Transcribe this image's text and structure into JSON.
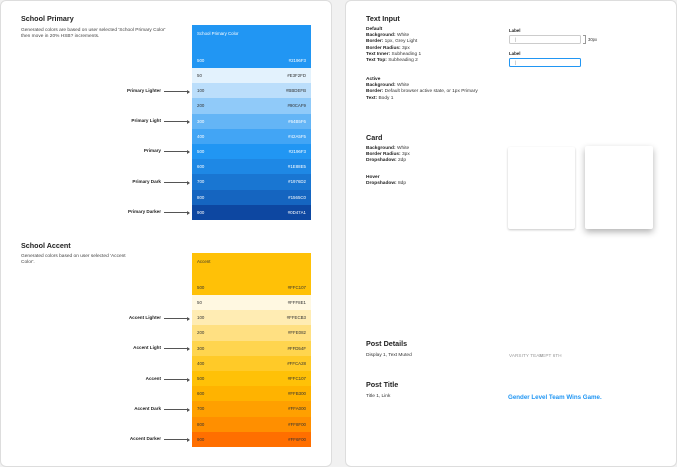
{
  "primary": {
    "title": "School Primary",
    "description": "Generated colors are based on user selected 'School Primary Color' then move in 20% HSB? increments.",
    "header": {
      "name": "School Primary Color",
      "step": "500",
      "hex": "#2196F3",
      "color": "#2196f3",
      "text_color": "#ffffff"
    },
    "rows": [
      {
        "step": "50",
        "hex": "#E3F2FD",
        "color": "#e3f2fd",
        "text_color": "#333333"
      },
      {
        "step": "100",
        "hex": "#BBDEFB",
        "color": "#bbdefb",
        "text_color": "#333333"
      },
      {
        "step": "200",
        "hex": "#90CAF9",
        "color": "#90caf9",
        "text_color": "#333333"
      },
      {
        "step": "300",
        "hex": "#64B5F6",
        "color": "#64b5f6",
        "text_color": "#ffffff"
      },
      {
        "step": "400",
        "hex": "#42A5F5",
        "color": "#42a5f5",
        "text_color": "#ffffff"
      },
      {
        "step": "500",
        "hex": "#2196F3",
        "color": "#2196f3",
        "text_color": "#ffffff"
      },
      {
        "step": "600",
        "hex": "#1E88E5",
        "color": "#1e88e5",
        "text_color": "#ffffff"
      },
      {
        "step": "700",
        "hex": "#1976D2",
        "color": "#1976d2",
        "text_color": "#ffffff"
      },
      {
        "step": "800",
        "hex": "#1565C0",
        "color": "#1565c0",
        "text_color": "#ffffff"
      },
      {
        "step": "900",
        "hex": "#0D47A1",
        "color": "#0d47a1",
        "text_color": "#ffffff"
      }
    ],
    "callouts": [
      "Primary Lighter",
      "Primary Light",
      "Primary",
      "Primary Dark",
      "Primary Darker"
    ]
  },
  "accent": {
    "title": "School Accent",
    "description": "Generated colors based on user selected 'Accent Color'.",
    "header": {
      "name": "Accent",
      "step": "500",
      "hex": "#FFC107",
      "color": "#ffc107",
      "text_color": "#333333"
    },
    "rows": [
      {
        "step": "50",
        "hex": "#FFF8E1",
        "color": "#fff8e1",
        "text_color": "#333333"
      },
      {
        "step": "100",
        "hex": "#FFECB3",
        "color": "#ffecb3",
        "text_color": "#333333"
      },
      {
        "step": "200",
        "hex": "#FFE082",
        "color": "#ffe082",
        "text_color": "#333333"
      },
      {
        "step": "300",
        "hex": "#FFD54F",
        "color": "#ffd54f",
        "text_color": "#333333"
      },
      {
        "step": "400",
        "hex": "#FFCA28",
        "color": "#ffca28",
        "text_color": "#333333"
      },
      {
        "step": "500",
        "hex": "#FFC107",
        "color": "#ffc107",
        "text_color": "#333333"
      },
      {
        "step": "600",
        "hex": "#FFB300",
        "color": "#ffb300",
        "text_color": "#333333"
      },
      {
        "step": "700",
        "hex": "#FFA000",
        "color": "#ffa000",
        "text_color": "#333333"
      },
      {
        "step": "800",
        "hex": "#FF8F00",
        "color": "#ff8f00",
        "text_color": "#333333"
      },
      {
        "step": "900",
        "hex": "#FF6F00",
        "color": "#ff6f00",
        "text_color": "#333333"
      }
    ],
    "callouts": [
      "Accent Lighter",
      "Accent Light",
      "Accent",
      "Accent Dark",
      "Accent Darker"
    ]
  },
  "text_input": {
    "title": "Text Input",
    "default": {
      "label": "Default",
      "lines": [
        {
          "key": "Background:",
          "value": "White"
        },
        {
          "key": "Border:",
          "value": "1px, Grey Light"
        },
        {
          "key": "Border Radius:",
          "value": "3px"
        },
        {
          "key": "Text Inner:",
          "value": "Subheading 1"
        },
        {
          "key": "Text Top:",
          "value": "Subheading 2"
        }
      ]
    },
    "active": {
      "label": "Active",
      "lines": [
        {
          "key": "Background:",
          "value": "White"
        },
        {
          "key": "Border:",
          "value": "Default browser active state, or 1px Primary"
        },
        {
          "key": "Text:",
          "value": "Body 1"
        }
      ]
    },
    "sample_label_1": "Label",
    "sample_value_1": "|",
    "sample_height_note": "30px",
    "sample_label_2": "Label",
    "sample_value_2": "|"
  },
  "card": {
    "title": "Card",
    "default_lines": [
      {
        "key": "Background:",
        "value": "White"
      },
      {
        "key": "Border Radius:",
        "value": "3px"
      },
      {
        "key": "Dropshadow:",
        "value": "2dp"
      }
    ],
    "hover_label": "Hover",
    "hover_lines": [
      {
        "key": "Dropshadow:",
        "value": "8dp"
      }
    ]
  },
  "post_details": {
    "title": "Post Details",
    "spec": "Display 1, Text Muted",
    "sample_team": "VARSITY TEAM",
    "sample_date": "SEPT 6TH"
  },
  "post_title": {
    "title": "Post Title",
    "spec": "Title 1, Link",
    "sample": "Gender Level Team Wins Game."
  },
  "colors": {
    "link": "#2196f3",
    "input_border": "#cccccc",
    "input_active_border": "#2196f3"
  }
}
